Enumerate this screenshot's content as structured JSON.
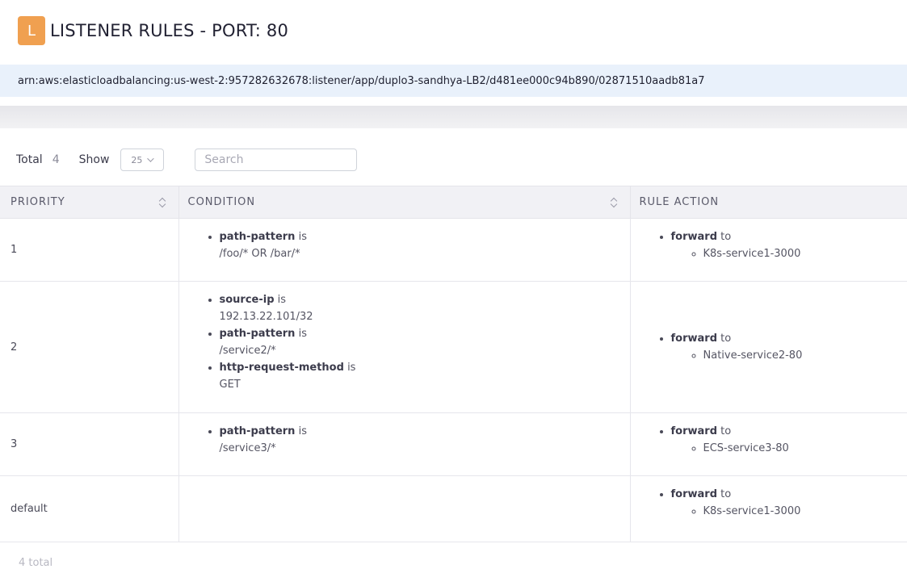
{
  "header": {
    "badge_letter": "L",
    "title": "LISTENER RULES - PORT: 80"
  },
  "arn": "arn:aws:elasticloadbalancing:us-west-2:957282632678:listener/app/duplo3-sandhya-LB2/d481ee000c94b890/02871510aadb81a7",
  "controls": {
    "total_label": "Total",
    "total_count": "4",
    "show_label": "Show",
    "page_size": "25",
    "search_placeholder": "Search"
  },
  "table": {
    "headers": [
      "PRIORITY",
      "CONDITION",
      "RULE ACTION"
    ],
    "rows": [
      {
        "priority": "1",
        "conditions": [
          {
            "field": "path-pattern",
            "op": "is",
            "value": "/foo/* OR /bar/*"
          }
        ],
        "action": {
          "type": "forward",
          "op": "to",
          "target": "K8s-service1-3000"
        }
      },
      {
        "priority": "2",
        "conditions": [
          {
            "field": "source-ip",
            "op": "is",
            "value": "192.13.22.101/32"
          },
          {
            "field": "path-pattern",
            "op": "is",
            "value": "/service2/*"
          },
          {
            "field": "http-request-method",
            "op": "is",
            "value": "GET"
          }
        ],
        "action": {
          "type": "forward",
          "op": "to",
          "target": "Native-service2-80"
        }
      },
      {
        "priority": "3",
        "conditions": [
          {
            "field": "path-pattern",
            "op": "is",
            "value": "/service3/*"
          }
        ],
        "action": {
          "type": "forward",
          "op": "to",
          "target": "ECS-service3-80"
        }
      },
      {
        "priority": "default",
        "conditions": [],
        "action": {
          "type": "forward",
          "op": "to",
          "target": "K8s-service1-3000"
        }
      }
    ]
  },
  "footer": {
    "total_text": "4 total"
  }
}
